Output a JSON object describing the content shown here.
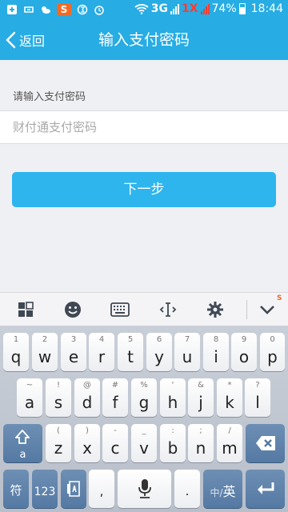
{
  "status_bar": {
    "network_a": "3G",
    "network_b": "1X",
    "battery": "74%",
    "time": "18:44",
    "icons": [
      "plus-square-icon",
      "usb-icon",
      "weather-icon",
      "sogou-icon",
      "notification-icon",
      "alarm-icon",
      "wifi-icon",
      "signal-icon",
      "battery-icon"
    ]
  },
  "header": {
    "back_label": "返回",
    "title": "输入支付密码"
  },
  "form": {
    "label": "请输入支付密码",
    "placeholder": "财付通支付密码",
    "value": "",
    "submit_label": "下一步"
  },
  "keyboard_toolbar": {
    "icons": [
      "grid-icon",
      "emoji-icon",
      "keyboard-icon",
      "cursor-icon",
      "gear-icon",
      "collapse-icon"
    ]
  },
  "keyboard": {
    "row1": [
      {
        "main": "q",
        "sub": "1"
      },
      {
        "main": "w",
        "sub": "2"
      },
      {
        "main": "e",
        "sub": "3"
      },
      {
        "main": "r",
        "sub": "4"
      },
      {
        "main": "t",
        "sub": "5"
      },
      {
        "main": "y",
        "sub": "6"
      },
      {
        "main": "u",
        "sub": "7"
      },
      {
        "main": "i",
        "sub": "8"
      },
      {
        "main": "o",
        "sub": "9"
      },
      {
        "main": "p",
        "sub": "0"
      }
    ],
    "row2": [
      {
        "main": "a",
        "sub": "~"
      },
      {
        "main": "s",
        "sub": "!"
      },
      {
        "main": "d",
        "sub": "@"
      },
      {
        "main": "f",
        "sub": "#"
      },
      {
        "main": "g",
        "sub": "%"
      },
      {
        "main": "h",
        "sub": "'"
      },
      {
        "main": "j",
        "sub": "&"
      },
      {
        "main": "k",
        "sub": "*"
      },
      {
        "main": "l",
        "sub": "?"
      }
    ],
    "row3": [
      {
        "main": "z",
        "sub": "("
      },
      {
        "main": "x",
        "sub": ")"
      },
      {
        "main": "c",
        "sub": "-"
      },
      {
        "main": "v",
        "sub": "_"
      },
      {
        "main": "b",
        "sub": ":"
      },
      {
        "main": "n",
        "sub": ";"
      },
      {
        "main": "m",
        "sub": "/"
      }
    ],
    "shift_label": "a",
    "symbol_label": "符",
    "num_label": "123",
    "comma_label": ",",
    "period_label": ".",
    "lang_label_a": "中/",
    "lang_label_b": "英"
  }
}
